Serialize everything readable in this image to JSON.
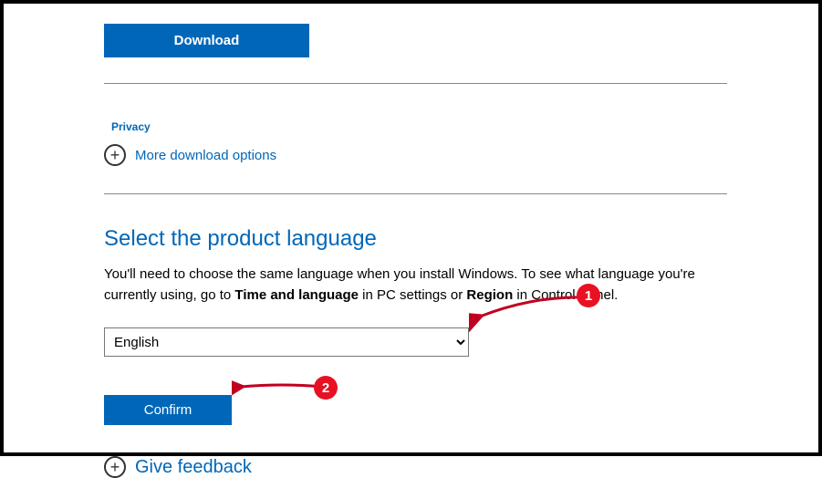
{
  "top": {
    "download_label": "Download",
    "privacy_label": "Privacy",
    "more_options_label": "More download options"
  },
  "language_section": {
    "heading": "Select the product language",
    "instruction_prefix": "You'll need to choose the same language when you install Windows. To see what language you're currently using, go to ",
    "bold1": "Time and language",
    "mid1": " in PC settings or ",
    "bold2": "Region",
    "suffix": " in Control Panel.",
    "selected_language": "English",
    "confirm_label": "Confirm"
  },
  "feedback": {
    "label": "Give feedback"
  },
  "annotations": {
    "step1": "1",
    "step2": "2"
  }
}
